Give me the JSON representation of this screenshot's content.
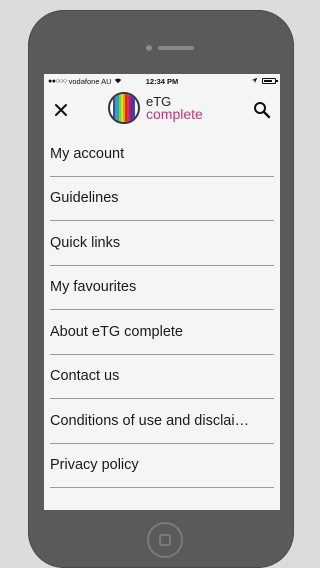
{
  "status_bar": {
    "signal": "●●○○○",
    "carrier": "vodafone AU",
    "wifi_icon": "wifi-icon",
    "time": "12:34 PM",
    "location_icon": "location-arrow-icon",
    "battery_icon": "battery-icon"
  },
  "header": {
    "close_icon": "close-icon",
    "logo_top": "eTG",
    "logo_bottom": "complete",
    "search_icon": "search-icon"
  },
  "colors": {
    "accent": "#c0357a",
    "phone_body": "#5a5a5a",
    "screen_bg": "#f5f5f5"
  },
  "menu": {
    "items": [
      {
        "label": "My account"
      },
      {
        "label": "Guidelines"
      },
      {
        "label": "Quick links"
      },
      {
        "label": "My favourites"
      },
      {
        "label": "About eTG complete"
      },
      {
        "label": "Contact us"
      },
      {
        "label": "Conditions of use and disclai…"
      },
      {
        "label": "Privacy policy"
      }
    ]
  }
}
